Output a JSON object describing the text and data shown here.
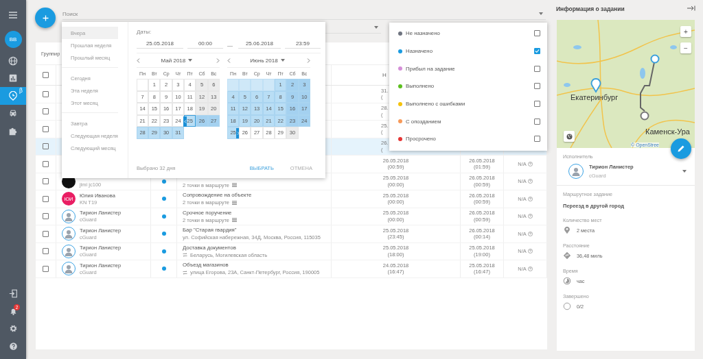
{
  "sidebar": {
    "avatar": "BB",
    "beta_mark": "β",
    "notification_count": "2",
    "items": [
      {
        "selected": false
      },
      {
        "selected": false
      },
      {
        "selected": true
      },
      {
        "selected": false
      },
      {
        "selected": false
      }
    ]
  },
  "search": {
    "placeholder": "Поиск"
  },
  "group_label": "Группир",
  "table": {
    "header_fragment": "Н",
    "header_checked": false,
    "rows": [
      {
        "kind": "covered",
        "checked": false,
        "selected": false,
        "start": "31.",
        "start_time": "("
      },
      {
        "kind": "covered",
        "checked": false,
        "selected": false,
        "start": "28.",
        "start_time": "("
      },
      {
        "kind": "covered",
        "checked": false,
        "selected": false,
        "start": "25.",
        "start_time": "("
      },
      {
        "kind": "covered",
        "checked": false,
        "selected": true,
        "start": "26.",
        "start_time": "("
      },
      {
        "kind": "tail",
        "checked": false,
        "selected": false,
        "start": "26.05.2018",
        "start_time": "(00:59)",
        "end": "26.05.2018",
        "end_time": "(01:59)",
        "extra": "N/A"
      },
      {
        "kind": "full",
        "checked": false,
        "selected": false,
        "executor": {
          "kind": "dark",
          "sub": "jimi jc100"
        },
        "color": "#1a9be0",
        "route": {
          "kind": "points",
          "text": "2 точки в маршруте"
        },
        "start": "25.05.2018",
        "start_time": "(00:00)",
        "end": "26.05.2018",
        "end_time": "(00:59)",
        "extra": "N/A"
      },
      {
        "kind": "full",
        "checked": false,
        "selected": false,
        "executor": {
          "kind": "initials",
          "initials": "ЮИ",
          "name": "Юлия Иванова",
          "sub": "KN T19"
        },
        "color": "#1a9be0",
        "task": "Сопровождение на объекте",
        "route": {
          "kind": "points",
          "text": "2 точки в маршруте"
        },
        "start": "25.05.2018",
        "start_time": "(00:00)",
        "end": "26.05.2018",
        "end_time": "(00:59)",
        "extra": "N/A"
      },
      {
        "kind": "full",
        "checked": false,
        "selected": false,
        "executor": {
          "kind": "photo",
          "name": "Тирион Ланистер",
          "sub": "cGuard"
        },
        "color": "#1a9be0",
        "task": "Срочное поручение",
        "route": {
          "kind": "points",
          "text": "2 точки в маршруте"
        },
        "start": "25.05.2018",
        "start_time": "(00:00)",
        "end": "26.05.2018",
        "end_time": "(00:59)",
        "extra": "N/A"
      },
      {
        "kind": "full",
        "checked": false,
        "selected": false,
        "executor": {
          "kind": "photo",
          "name": "Тирион Ланистер",
          "sub": "cGuard"
        },
        "color": "#1a9be0",
        "task": "Бар \"Старая гвардия\"",
        "route": {
          "kind": "plain",
          "text": "ул. Софийская набережная, 34Д, Москва, Россия, 115035"
        },
        "start": "25.05.2018",
        "start_time": "(23:45)",
        "end": "26.05.2018",
        "end_time": "(00:14)",
        "extra": "N/A"
      },
      {
        "kind": "full",
        "checked": false,
        "selected": false,
        "executor": {
          "kind": "photo",
          "name": "Тирион Ланистер",
          "sub": "cGuard"
        },
        "color": "#1a9be0",
        "task": "Доставка документов",
        "route": {
          "kind": "swap",
          "text": "Беларусь, Могилевская область"
        },
        "start": "25.05.2018",
        "start_time": "(18:00)",
        "end": "25.05.2018",
        "end_time": "(19:00)",
        "extra": "N/A"
      },
      {
        "kind": "full",
        "checked": false,
        "selected": false,
        "executor": {
          "kind": "photo",
          "name": "Тирион Ланистер",
          "sub": "cGuard"
        },
        "color": "#1a9be0",
        "task": "Объезд магазинов",
        "route": {
          "kind": "swap",
          "text": "улица Егорова, 23А, Санкт-Петербург, Россия, 190005"
        },
        "start": "24.05.2018",
        "start_time": "(16:47)",
        "end": "25.05.2018",
        "end_time": "(16:47)",
        "extra": "N/A"
      }
    ]
  },
  "date_picker": {
    "presets": [
      [
        {
          "label": "Вчера",
          "selected": true
        },
        {
          "label": "Прошлая неделя",
          "selected": false
        },
        {
          "label": "Прошлый месяц",
          "selected": false
        }
      ],
      [
        {
          "label": "Сегодня",
          "selected": false
        },
        {
          "label": "Эта неделя",
          "selected": false
        },
        {
          "label": "Этот месяц",
          "selected": false
        }
      ],
      [
        {
          "label": "Завтра",
          "selected": false
        },
        {
          "label": "Следующая неделя",
          "selected": false
        },
        {
          "label": "Следующий месяц",
          "selected": false
        }
      ]
    ],
    "label": "Даты:",
    "from_date": "25.05.2018",
    "from_time": "00:00",
    "dash": "—",
    "to_date": "25.06.2018",
    "to_time": "23:59",
    "months": [
      {
        "title": "Май 2018",
        "weekdays": [
          "Пн",
          "Вт",
          "Ср",
          "Чт",
          "Пт",
          "Сб",
          "Вс"
        ],
        "days": [
          {
            "kind": "blank",
            "in_range": false
          },
          {
            "day": "1",
            "weekend": false,
            "in_range": false
          },
          {
            "day": "2",
            "weekend": false,
            "in_range": false
          },
          {
            "day": "3",
            "weekend": false,
            "in_range": false
          },
          {
            "day": "4",
            "weekend": false,
            "in_range": false
          },
          {
            "day": "5",
            "weekend": true,
            "in_range": false
          },
          {
            "day": "6",
            "weekend": true,
            "in_range": false
          },
          {
            "day": "7",
            "weekend": false,
            "in_range": false
          },
          {
            "day": "8",
            "weekend": false,
            "in_range": false
          },
          {
            "day": "9",
            "weekend": false,
            "in_range": false
          },
          {
            "day": "10",
            "weekend": false,
            "in_range": false
          },
          {
            "day": "11",
            "weekend": false,
            "in_range": false
          },
          {
            "day": "12",
            "weekend": true,
            "in_range": false
          },
          {
            "day": "13",
            "weekend": true,
            "in_range": false
          },
          {
            "day": "14",
            "weekend": false,
            "in_range": false
          },
          {
            "day": "15",
            "weekend": false,
            "in_range": false
          },
          {
            "day": "16",
            "weekend": false,
            "in_range": false
          },
          {
            "day": "17",
            "weekend": false,
            "in_range": false
          },
          {
            "day": "18",
            "weekend": false,
            "in_range": false
          },
          {
            "day": "19",
            "weekend": true,
            "in_range": false
          },
          {
            "day": "20",
            "weekend": true,
            "in_range": false
          },
          {
            "day": "21",
            "weekend": false,
            "in_range": false
          },
          {
            "day": "22",
            "weekend": false,
            "in_range": false
          },
          {
            "day": "23",
            "weekend": false,
            "in_range": false
          },
          {
            "day": "24",
            "weekend": false,
            "in_range": false
          },
          {
            "kind": "start",
            "day": "25",
            "weekend": false,
            "in_range": true
          },
          {
            "day": "26",
            "weekend": true,
            "in_range": true
          },
          {
            "day": "27",
            "weekend": true,
            "in_range": true
          },
          {
            "day": "28",
            "weekend": false,
            "in_range": true
          },
          {
            "day": "29",
            "weekend": false,
            "in_range": true
          },
          {
            "day": "30",
            "weekend": false,
            "in_range": true
          },
          {
            "day": "31",
            "weekend": false,
            "in_range": true
          }
        ]
      },
      {
        "title": "Июнь 2018",
        "weekdays": [
          "Пн",
          "Вт",
          "Ср",
          "Чт",
          "Пт",
          "Сб",
          "Вс"
        ],
        "days": [
          {
            "kind": "blank",
            "in_range": true
          },
          {
            "kind": "blank",
            "in_range": true
          },
          {
            "kind": "blank",
            "in_range": true
          },
          {
            "kind": "blank",
            "in_range": true
          },
          {
            "day": "1",
            "weekend": false,
            "in_range": true
          },
          {
            "day": "2",
            "weekend": true,
            "in_range": true
          },
          {
            "day": "3",
            "weekend": true,
            "in_range": true
          },
          {
            "day": "4",
            "weekend": false,
            "in_range": true
          },
          {
            "day": "5",
            "weekend": false,
            "in_range": true
          },
          {
            "day": "6",
            "weekend": false,
            "in_range": true
          },
          {
            "day": "7",
            "weekend": false,
            "in_range": true
          },
          {
            "day": "8",
            "weekend": false,
            "in_range": true
          },
          {
            "day": "9",
            "weekend": true,
            "in_range": true
          },
          {
            "day": "10",
            "weekend": true,
            "in_range": true
          },
          {
            "day": "11",
            "weekend": false,
            "in_range": true
          },
          {
            "day": "12",
            "weekend": false,
            "in_range": true
          },
          {
            "day": "13",
            "weekend": false,
            "in_range": true
          },
          {
            "day": "14",
            "weekend": false,
            "in_range": true
          },
          {
            "day": "15",
            "weekend": false,
            "in_range": true
          },
          {
            "day": "16",
            "weekend": true,
            "in_range": true
          },
          {
            "day": "17",
            "weekend": true,
            "in_range": true
          },
          {
            "day": "18",
            "weekend": false,
            "in_range": true
          },
          {
            "day": "19",
            "weekend": false,
            "in_range": true
          },
          {
            "day": "20",
            "weekend": false,
            "in_range": true
          },
          {
            "day": "21",
            "weekend": false,
            "in_range": true
          },
          {
            "day": "22",
            "weekend": false,
            "in_range": true
          },
          {
            "day": "23",
            "weekend": true,
            "in_range": true
          },
          {
            "day": "24",
            "weekend": true,
            "in_range": true
          },
          {
            "kind": "end",
            "day": "25",
            "weekend": false,
            "in_range": true
          },
          {
            "day": "26",
            "weekend": false,
            "in_range": false
          },
          {
            "day": "27",
            "weekend": false,
            "in_range": false
          },
          {
            "day": "28",
            "weekend": false,
            "in_range": false
          },
          {
            "day": "29",
            "weekend": false,
            "in_range": false
          },
          {
            "day": "30",
            "weekend": true,
            "in_range": false
          }
        ]
      }
    ],
    "summary": "Выбрано 32 дня",
    "ok": "ВЫБРАТЬ",
    "cancel": "ОТМЕНА"
  },
  "status_menu": [
    {
      "label": "Не назначено",
      "color": "#6f7480",
      "checked": false
    },
    {
      "label": "Назначено",
      "color": "#1a9be0",
      "checked": true
    },
    {
      "label": "Прибыл на задание",
      "color": "#d58fd8",
      "checked": false
    },
    {
      "label": "Выполнено",
      "color": "#5cbf1f",
      "checked": false
    },
    {
      "label": "Выполнено с ошибками",
      "color": "#f5c20b",
      "checked": false
    },
    {
      "label": "С опозданием",
      "color": "#f79a5a",
      "checked": false
    },
    {
      "label": "Просрочено",
      "color": "#e53535",
      "checked": false
    }
  ],
  "panel": {
    "title": "Информация о задании",
    "map": {
      "labels": [
        "Екатеринбург",
        "Каменск-Ура"
      ],
      "attribution": "© OpenStree",
      "zoom_in": "+",
      "zoom_out": "−"
    },
    "executor_label": "Исполнитель",
    "executor_name": "Тирион Ланистер",
    "executor_sub": "cGuard",
    "route_label": "Маршрутное задание",
    "route_value": "Переезд в другой город",
    "facts": [
      {
        "label": "Количество мест",
        "value": "2 места"
      },
      {
        "label": "Расстояние",
        "value": "36,48 миль"
      },
      {
        "label": "Время",
        "value": "час"
      },
      {
        "label": "Завершено",
        "value": "0/2"
      }
    ]
  }
}
